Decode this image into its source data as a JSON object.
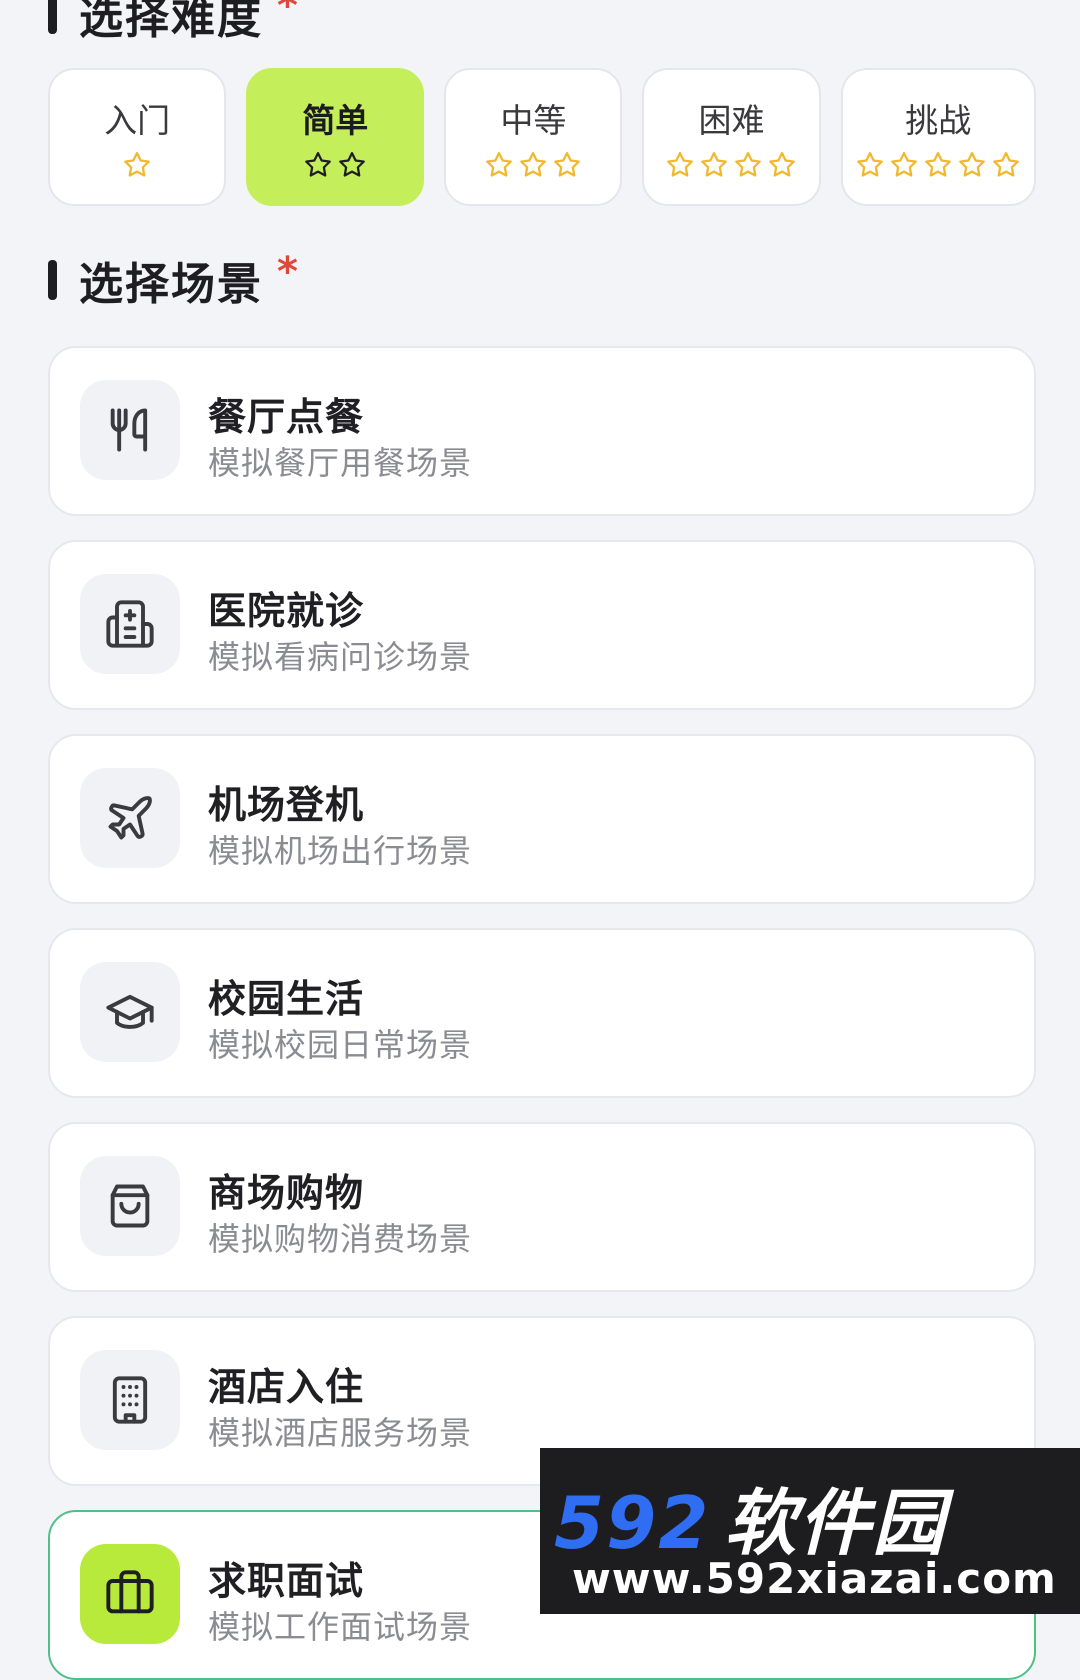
{
  "difficulty": {
    "title": "选择难度",
    "required_mark": "*",
    "options": [
      {
        "label": "入门",
        "stars": 1
      },
      {
        "label": "简单",
        "stars": 2,
        "selected": true
      },
      {
        "label": "中等",
        "stars": 3
      },
      {
        "label": "困难",
        "stars": 4
      },
      {
        "label": "挑战",
        "stars": 5
      }
    ]
  },
  "scene": {
    "title": "选择场景",
    "required_mark": "*",
    "items": [
      {
        "name": "餐厅点餐",
        "desc": "模拟餐厅用餐场景",
        "icon": "utensils-icon"
      },
      {
        "name": "医院就诊",
        "desc": "模拟看病问诊场景",
        "icon": "hospital-icon"
      },
      {
        "name": "机场登机",
        "desc": "模拟机场出行场景",
        "icon": "airplane-icon"
      },
      {
        "name": "校园生活",
        "desc": "模拟校园日常场景",
        "icon": "graduation-cap-icon"
      },
      {
        "name": "商场购物",
        "desc": "模拟购物消费场景",
        "icon": "shopping-bag-icon"
      },
      {
        "name": "酒店入住",
        "desc": "模拟酒店服务场景",
        "icon": "building-icon"
      },
      {
        "name": "求职面试",
        "desc": "模拟工作面试场景",
        "icon": "briefcase-icon",
        "selected": true
      }
    ]
  },
  "watermark": {
    "brand_num": "592",
    "brand_cn": "软件园",
    "url": "www.592xiazai.com"
  },
  "colors": {
    "accent": "#c5ef5a",
    "star": "#f1b82c",
    "required": "#e0473b",
    "active_border": "#4fbf8a"
  }
}
